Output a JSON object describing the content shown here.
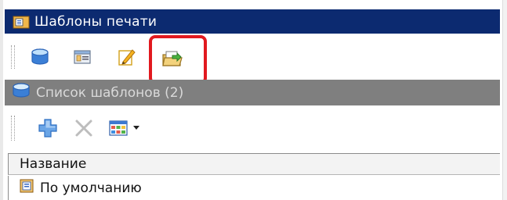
{
  "window": {
    "title": "Шаблоны печати"
  },
  "toolbar": {
    "buttons": [
      {
        "icon": "database-icon"
      },
      {
        "icon": "form-icon"
      },
      {
        "icon": "edit-icon"
      },
      {
        "icon": "folder-open-arrow-icon",
        "highlighted": true
      }
    ]
  },
  "template_list": {
    "title": "Список шаблонов (2)",
    "buttons": [
      {
        "icon": "add-plus-icon"
      },
      {
        "icon": "delete-cross-icon",
        "disabled": true
      },
      {
        "icon": "table-grid-icon",
        "has_dropdown": true
      }
    ],
    "columns": [
      "Название"
    ],
    "rows": [
      {
        "name": "По умолчанию",
        "icon": "template-doc-icon"
      }
    ]
  },
  "colors": {
    "title_bg": "#0c2a70",
    "subheader_bg": "#7f7f7f",
    "highlight": "#e1191f"
  }
}
